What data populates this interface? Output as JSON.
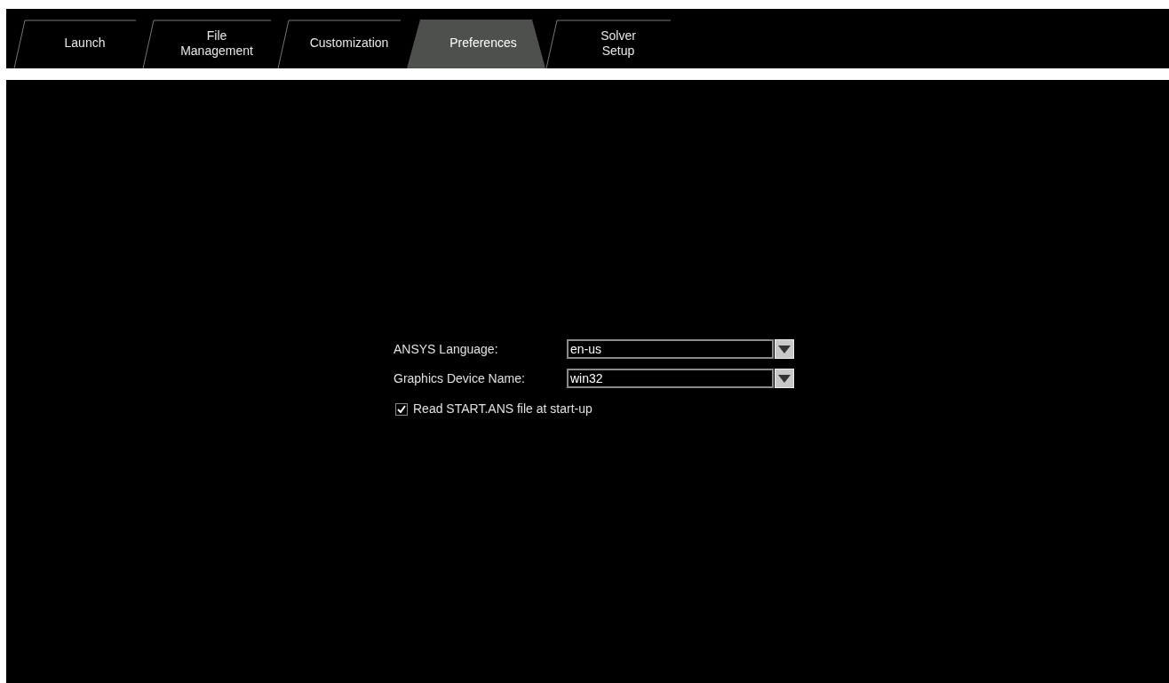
{
  "tabs": [
    {
      "label": "Launch",
      "selected": false
    },
    {
      "label": "File\nManagement",
      "selected": false
    },
    {
      "label": "Customization",
      "selected": false
    },
    {
      "label": "Preferences",
      "selected": true
    },
    {
      "label": "Solver\nSetup",
      "selected": false
    }
  ],
  "fields": [
    {
      "label": "ANSYS Language:",
      "value": "en-us"
    },
    {
      "label": "Graphics Device Name:",
      "value": "win32"
    }
  ],
  "checkbox": {
    "label": "Read START.ANS file at start-up",
    "checked": true
  }
}
